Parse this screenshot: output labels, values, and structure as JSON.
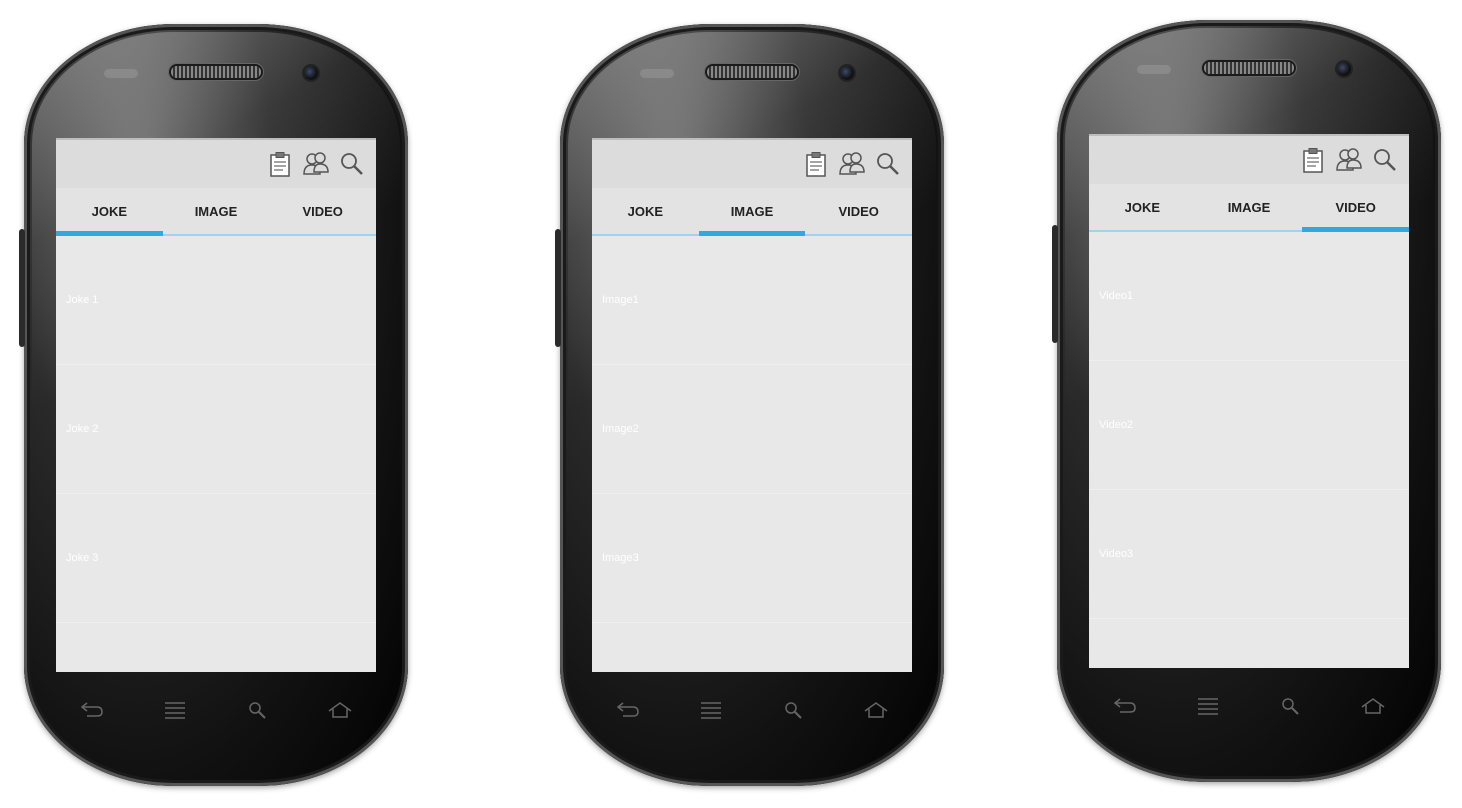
{
  "colors": {
    "accent": "#33a8dc",
    "screen_bg": "#e8e8e8",
    "actionbar_bg": "#dcdcdc"
  },
  "actionbar_icons": [
    "clipboard-icon",
    "people-icon",
    "search-icon"
  ],
  "nav_icons": [
    "back-icon",
    "menu-icon",
    "search-icon",
    "home-icon"
  ],
  "phones": [
    {
      "tabs": [
        {
          "label": "JOKE",
          "active": true
        },
        {
          "label": "IMAGE",
          "active": false
        },
        {
          "label": "VIDEO",
          "active": false
        }
      ],
      "items": [
        "Joke 1",
        "Joke 2",
        "Joke 3"
      ]
    },
    {
      "tabs": [
        {
          "label": "JOKE",
          "active": false
        },
        {
          "label": "IMAGE",
          "active": true
        },
        {
          "label": "VIDEO",
          "active": false
        }
      ],
      "items": [
        "Image1",
        "Image2",
        "Image3"
      ]
    },
    {
      "tabs": [
        {
          "label": "JOKE",
          "active": false
        },
        {
          "label": "IMAGE",
          "active": false
        },
        {
          "label": "VIDEO",
          "active": true
        }
      ],
      "items": [
        "Video1",
        "Video2",
        "Video3"
      ]
    }
  ]
}
